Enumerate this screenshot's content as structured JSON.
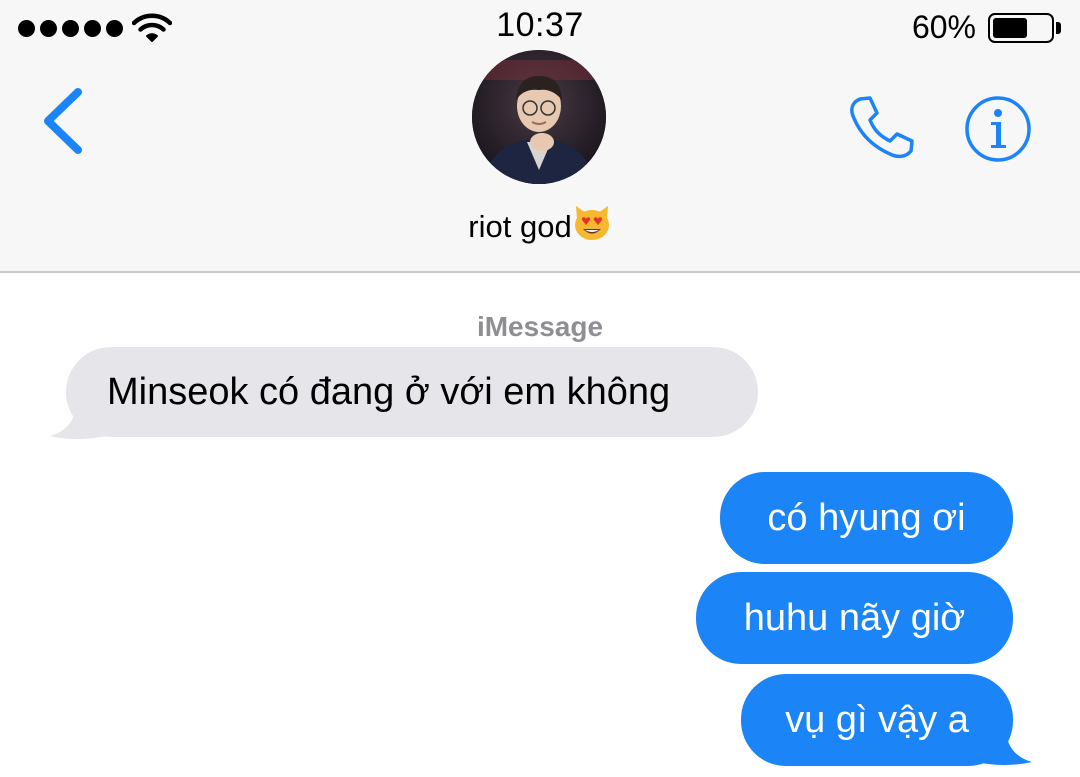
{
  "status_bar": {
    "time": "10:37",
    "battery_percent_label": "60%",
    "battery_level": 0.6,
    "signal_bars": 5,
    "icons": [
      "signal-dots-icon",
      "wifi-icon",
      "battery-icon"
    ]
  },
  "nav": {
    "contact_name": "riot god",
    "contact_emoji": "heart-eyes-cat-emoji",
    "icons": [
      "back-chevron-icon",
      "phone-icon",
      "info-icon"
    ],
    "accent_color": "#1b84f7"
  },
  "conversation": {
    "service_label": "iMessage",
    "messages": [
      {
        "direction": "incoming",
        "text": "Minseok có đang ở với em không"
      },
      {
        "direction": "outgoing",
        "text": "có hyung ơi"
      },
      {
        "direction": "outgoing",
        "text": "huhu nãy giờ"
      },
      {
        "direction": "outgoing",
        "text": "vụ gì vậy a"
      }
    ],
    "colors": {
      "incoming_bubble": "#e5e5ea",
      "outgoing_bubble": "#1b84f7"
    }
  }
}
